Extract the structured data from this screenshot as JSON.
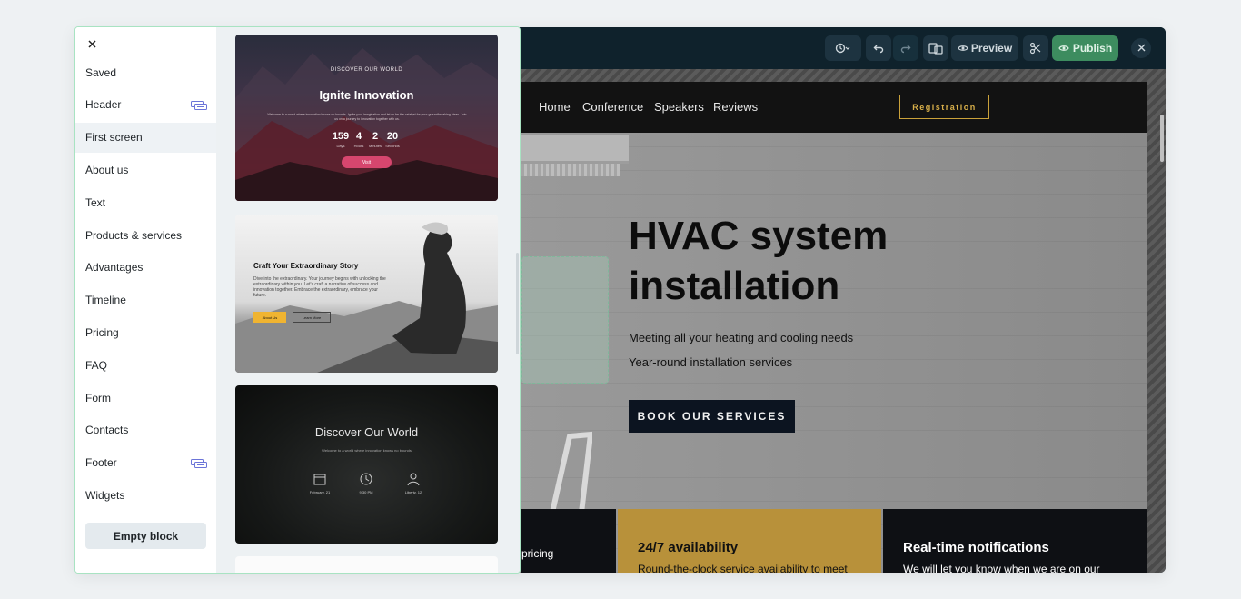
{
  "toolbar": {
    "history_icon": "history-icon",
    "preview_label": "Preview",
    "publish_label": "Publish"
  },
  "site": {
    "nav": [
      "Home",
      "Conference",
      "Speakers",
      "Reviews"
    ],
    "registration_label": "Registration",
    "hero_title_line1": "HVAC system",
    "hero_title_line2": "installation",
    "hero_sub1": "Meeting all your heating and cooling needs",
    "hero_sub2": "Year-round installation services",
    "book_label": "BOOK OUR SERVICES",
    "features": [
      {
        "title": "",
        "text": "pricing",
        "bg": "#0e1014",
        "color": "#ffffff"
      },
      {
        "title": "24/7 availability",
        "text": "Round-the-clock service availability to meet",
        "bg": "#b8913a",
        "color": "#111111"
      },
      {
        "title": "Real-time notifications",
        "text": "We will let you know when we are on our",
        "bg": "#0e1014",
        "color": "#ffffff"
      }
    ]
  },
  "panel": {
    "close_icon": "close-icon",
    "menu": [
      {
        "label": "Saved",
        "icon": false
      },
      {
        "label": "Header",
        "icon": true
      },
      {
        "label": "First screen",
        "icon": false,
        "active": true
      },
      {
        "label": "About us",
        "icon": false
      },
      {
        "label": "Text",
        "icon": false
      },
      {
        "label": "Products & services",
        "icon": false
      },
      {
        "label": "Advantages",
        "icon": false
      },
      {
        "label": "Timeline",
        "icon": false
      },
      {
        "label": "Pricing",
        "icon": false
      },
      {
        "label": "FAQ",
        "icon": false
      },
      {
        "label": "Form",
        "icon": false
      },
      {
        "label": "Contacts",
        "icon": false
      },
      {
        "label": "Footer",
        "icon": true
      },
      {
        "label": "Widgets",
        "icon": false
      }
    ],
    "empty_block_label": "Empty block",
    "thumb1": {
      "eyebrow": "DISCOVER OUR WORLD",
      "title": "Ignite Innovation",
      "text": "Welcome to a world where innovation knows no bounds. Ignite your imagination and let us be the catalyst for your groundbreaking ideas. Join us on a journey to innovation together with us.",
      "counts": [
        "159",
        "4",
        "2",
        "20"
      ],
      "count_labels": [
        "Days",
        "Hours",
        "Minutes",
        "Seconds"
      ],
      "button": "Visit"
    },
    "thumb2": {
      "title": "Craft Your Extraordinary Story",
      "text": "Dive into the extraordinary. Your journey begins with unlocking the extraordinary within you. Let's craft a narrative of success and innovation together. Embrace the extraordinary, embrace your future.",
      "btn1": "About Us",
      "btn2": "Learn More"
    },
    "thumb3": {
      "title": "Discover Our World",
      "sub": "Welcome to a world where innovation knows no bounds",
      "items": [
        "February, 21",
        "9:30 PM",
        "Liberty, 12"
      ]
    }
  }
}
